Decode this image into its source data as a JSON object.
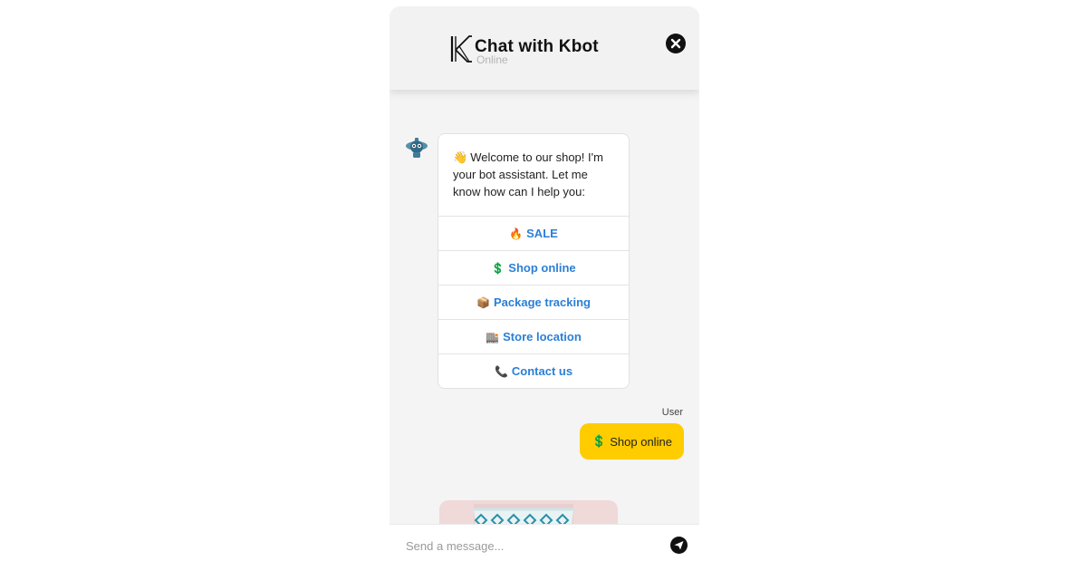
{
  "header": {
    "title": "Chat with Kbot",
    "status": "Online",
    "logo_icon": "kbot-logo-icon",
    "close_icon": "close-icon"
  },
  "bot_message": {
    "avatar_icon": "bot-avatar-icon",
    "wave_emoji": "👋",
    "text": "Welcome to our shop! I'm your bot assistant. Let me know how can I help you:",
    "options": [
      {
        "emoji": "🔥",
        "label": "SALE"
      },
      {
        "emoji": "💲",
        "label": "Shop online"
      },
      {
        "emoji": "📦",
        "label": "Package tracking"
      },
      {
        "emoji": "🏬",
        "label": "Store location"
      },
      {
        "emoji": "📞",
        "label": "Contact us"
      }
    ]
  },
  "user_message": {
    "sender": "User",
    "emoji": "💲",
    "text": "Shop online"
  },
  "composer": {
    "placeholder": "Send a message...",
    "send_icon": "send-icon"
  },
  "colors": {
    "accent": "#ffcc00",
    "link": "#2b7fd6",
    "background": "#f4f4f4"
  }
}
